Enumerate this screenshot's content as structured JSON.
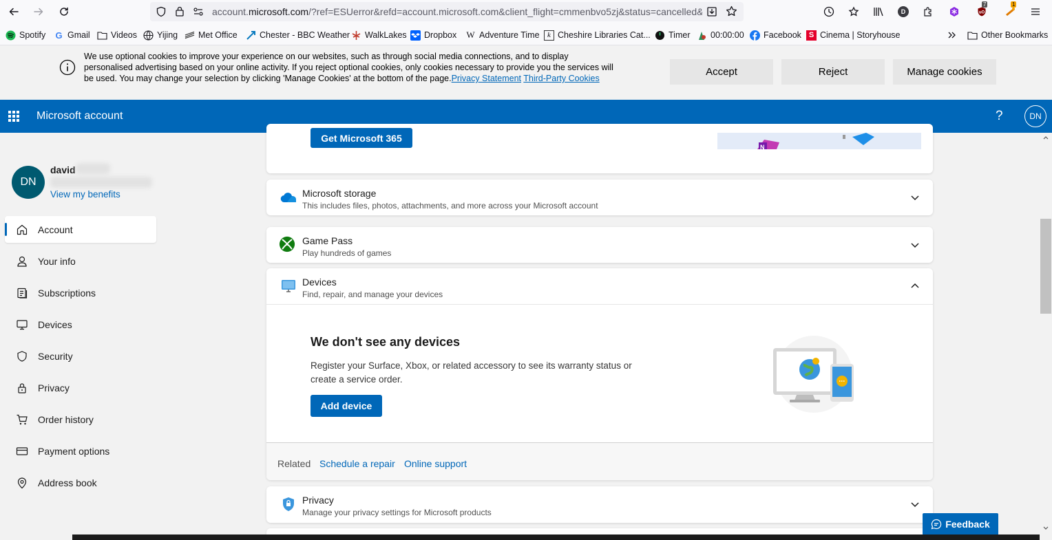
{
  "browser": {
    "url_prefix": "account.",
    "url_domain": "microsoft.com",
    "url_rest": "/?ref=ESUerror&refd=account.microsoft.com&client_flight=cmmenbvo5zj&status=cancelled&",
    "ext_badge_1": "7",
    "ext_badge_2": "1",
    "profile_letter": "D"
  },
  "bookmarks": [
    {
      "label": "Spotify",
      "icon": "spotify-icon"
    },
    {
      "label": "Gmail",
      "icon": "google-icon"
    },
    {
      "label": "Videos",
      "icon": "folder-icon"
    },
    {
      "label": "Yijing",
      "icon": "globe-icon"
    },
    {
      "label": "Met Office",
      "icon": "met-office-icon"
    },
    {
      "label": "Chester - BBC Weather",
      "icon": "weather-icon"
    },
    {
      "label": "WalkLakes",
      "icon": "walklakes-icon"
    },
    {
      "label": "Dropbox",
      "icon": "dropbox-icon"
    },
    {
      "label": "Adventure Time",
      "icon": "wikipedia-icon"
    },
    {
      "label": "Cheshire Libraries Cat...",
      "icon": "library-icon"
    },
    {
      "label": "Timer",
      "icon": "timer-icon"
    },
    {
      "label": "00:00:00",
      "icon": "stopwatch-icon"
    },
    {
      "label": "Facebook",
      "icon": "facebook-icon"
    },
    {
      "label": "Cinema | Storyhouse",
      "icon": "storyhouse-icon"
    }
  ],
  "other_bookmarks": "Other Bookmarks",
  "cookie": {
    "text": "We use optional cookies to improve your experience on our websites, such as through social media connections, and to display personalised advertising based on your online activity. If you reject optional cookies, only cookies necessary to provide you the services will be used. You may change your selection by clicking 'Manage Cookies' at the bottom of the page.",
    "privacy_link": "Privacy Statement",
    "third_party_link": "Third-Party Cookies",
    "accept": "Accept",
    "reject": "Reject",
    "manage": "Manage cookies"
  },
  "header": {
    "title": "Microsoft account",
    "help": "?",
    "avatar": "DN"
  },
  "sidebar": {
    "avatar": "DN",
    "name": "david",
    "benefits": "View my benefits",
    "items": [
      {
        "label": "Account",
        "icon": "home-icon"
      },
      {
        "label": "Your info",
        "icon": "person-icon"
      },
      {
        "label": "Subscriptions",
        "icon": "subscriptions-icon"
      },
      {
        "label": "Devices",
        "icon": "monitor-icon"
      },
      {
        "label": "Security",
        "icon": "shield-icon"
      },
      {
        "label": "Privacy",
        "icon": "lock-icon"
      },
      {
        "label": "Order history",
        "icon": "cart-icon"
      },
      {
        "label": "Payment options",
        "icon": "card-icon"
      },
      {
        "label": "Address book",
        "icon": "location-pin-icon"
      }
    ]
  },
  "main": {
    "m365_button": "Get Microsoft 365",
    "storage": {
      "title": "Microsoft storage",
      "sub": "This includes files, photos, attachments, and more across your Microsoft account"
    },
    "gamepass": {
      "title": "Game Pass",
      "sub": "Play hundreds of games"
    },
    "devices": {
      "title": "Devices",
      "sub": "Find, repair, and manage your devices",
      "heading": "We don't see any devices",
      "body": "Register your Surface, Xbox, or related accessory to see its warranty status or create a service order.",
      "button": "Add device",
      "related": "Related",
      "repair": "Schedule a repair",
      "support": "Online support"
    },
    "privacy": {
      "title": "Privacy",
      "sub": "Manage your privacy settings for Microsoft products"
    }
  },
  "feedback": "Feedback",
  "colors": {
    "accent": "#0067b8",
    "avatar": "#005a70"
  }
}
